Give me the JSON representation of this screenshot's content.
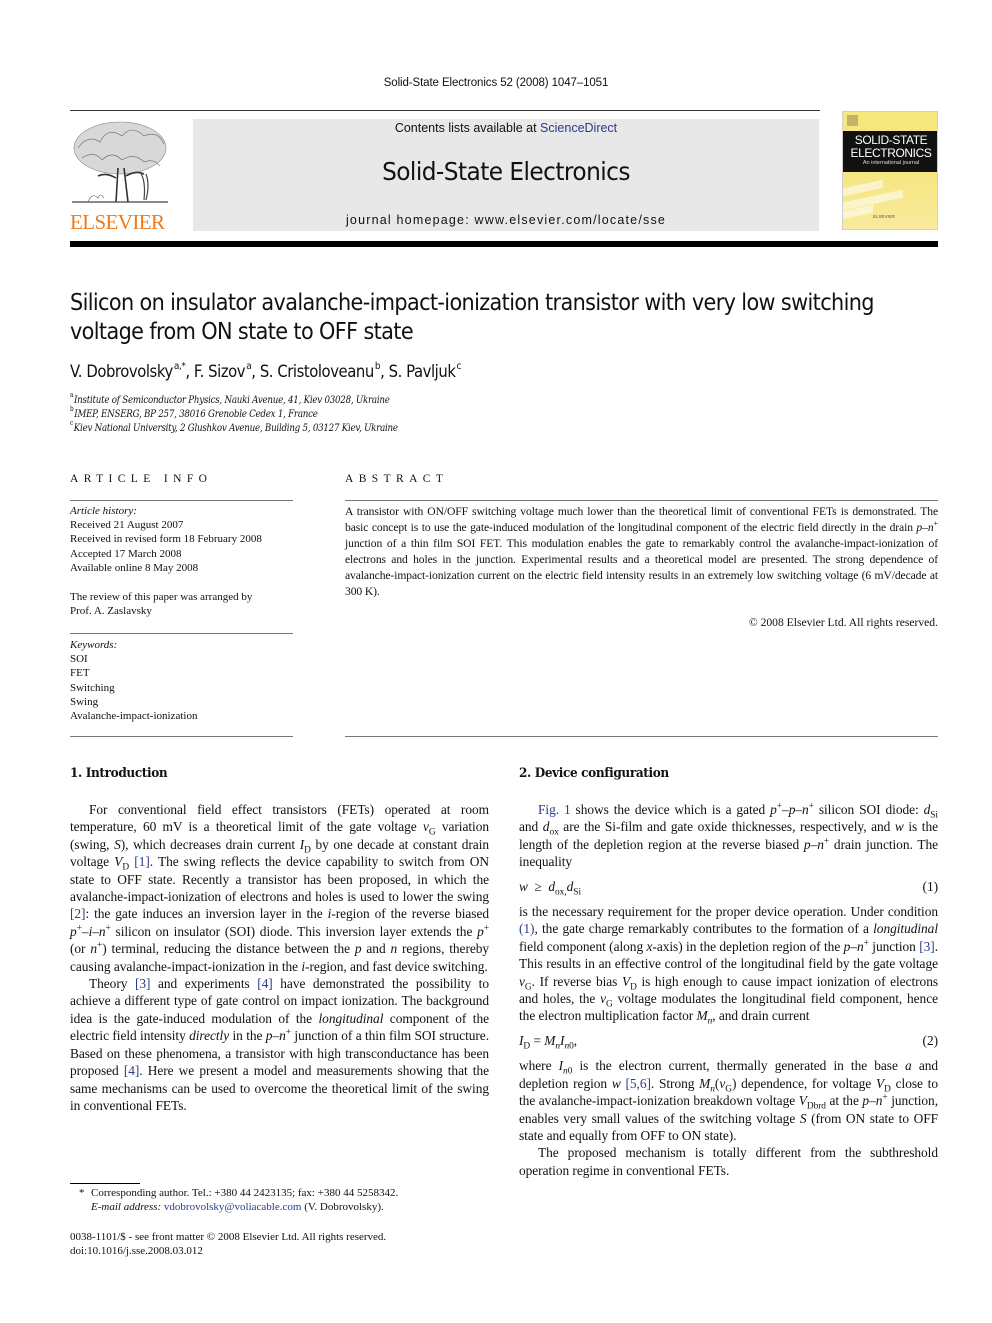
{
  "running_head": "Solid-State Electronics 52 (2008) 1047–1051",
  "header": {
    "publisher_logo_text": "ELSEVIER",
    "contents_prefix": "Contents lists available at ",
    "contents_link": "ScienceDirect",
    "journal_name": "Solid-State Electronics",
    "homepage": "journal homepage: www.elsevier.com/locate/sse",
    "cover": {
      "title_line1": "SOLID-STATE",
      "title_line2": "ELECTRONICS",
      "subtitle": "An international journal",
      "publisher": "ELSEVIER"
    },
    "colors": {
      "elsevier_orange": "#f07a16",
      "link_blue": "#2a3a8c",
      "box_gray": "#e8e8e8",
      "cover_yellow": "#f6e47a"
    }
  },
  "article": {
    "title": "Silicon on insulator avalanche-impact-ionization transistor with very low switching voltage from ON state to OFF state",
    "authors": [
      {
        "name": "V. Dobrovolsky",
        "sup": "a,*"
      },
      {
        "name": "F. Sizov",
        "sup": "a"
      },
      {
        "name": "S. Cristoloveanu",
        "sup": "b"
      },
      {
        "name": "S. Pavljuk",
        "sup": "c"
      }
    ],
    "affiliations": [
      {
        "mark": "a",
        "text": "Institute of Semiconductor Physics, Nauki Avenue, 41, Kiev 03028, Ukraine"
      },
      {
        "mark": "b",
        "text": "IMEP, ENSERG, BP 257, 38016 Grenoble Cedex 1, France"
      },
      {
        "mark": "c",
        "text": "Kiev National University, 2 Glushkov Avenue, Building 5, 03127 Kiev, Ukraine"
      }
    ]
  },
  "article_info": {
    "heading": "ARTICLE INFO",
    "history_label": "Article history:",
    "history": [
      "Received 21 August 2007",
      "Received in revised form 18 February 2008",
      "Accepted 17 March 2008",
      "Available online 8 May 2008"
    ],
    "review_note": [
      "The review of this paper was arranged by",
      "Prof. A. Zaslavsky"
    ],
    "keywords_label": "Keywords:",
    "keywords": [
      "SOI",
      "FET",
      "Switching",
      "Swing",
      "Avalanche-impact-ionization"
    ]
  },
  "abstract": {
    "heading": "ABSTRACT",
    "text_html": "A transistor with ON/OFF switching voltage much lower than the theoretical limit of conventional FETs is demonstrated. The basic concept is to use the gate-induced modulation of the longitudinal component of the electric field directly in the drain <i>p</i>–<i>n</i><sup>+</sup> junction of a thin film SOI FET. This modulation enables the gate to remarkably control the avalanche-impact-ionization of electrons and holes in the junction. Experimental results and a theoretical model are presented. The strong dependence of avalanche-impact-ionization current on the electric field intensity results in an extremely low switching voltage (6 mV/decade at 300 K).",
    "copyright": "© 2008 Elsevier Ltd. All rights reserved."
  },
  "sections": {
    "intro": {
      "heading": "1. Introduction",
      "paragraphs_html": [
        "For conventional field effect transistors (FETs) operated at room temperature, 60 mV is a theoretical limit of the gate voltage <i>v</i><sub>G</sub> variation (swing, <i>S</i>), which decreases drain current <i>I</i><sub>D</sub> by one decade at constant drain voltage <i>V</i><sub>D</sub> <span class=\"link\">[1]</span>. The swing reflects the device capability to switch from ON state to OFF state. Recently a transistor has been proposed, in which the avalanche-impact-ionization of electrons and holes is used to lower the swing <span class=\"link\">[2]</span>: the gate induces an inversion layer in the <i>i</i>-region of the reverse biased <i>p</i><sup>+</sup>–<i>i</i>–<i>n</i><sup>+</sup> silicon on insulator (SOI) diode. This inversion layer extends the <i>p</i><sup>+</sup> (or <i>n</i><sup>+</sup>) terminal, reducing the distance between the <i>p</i> and <i>n</i> regions, thereby causing avalanche-impact-ionization in the <i>i</i>-region, and fast device switching.",
        "Theory <span class=\"link\">[3]</span> and experiments <span class=\"link\">[4]</span> have demonstrated the possibility to achieve a different type of gate control on impact ionization. The background idea is the gate-induced modulation of the <i>longitudinal</i> component of the electric field intensity <i>directly</i> in the <i>p</i>–<i>n</i><sup>+</sup> junction of a thin film SOI structure. Based on these phenomena, a transistor with high transconductance has been proposed <span class=\"link\">[4]</span>. Here we present a model and measurements showing that the same mechanisms can be used to overcome the theoretical limit of the swing in conventional FETs."
      ]
    },
    "device": {
      "heading": "2. Device configuration",
      "para1_html": "<span class=\"link\">Fig. 1</span> shows the device which is a gated <i>p</i><sup>+</sup>–<i>p</i>–<i>n</i><sup>+</sup> silicon SOI diode: <i>d</i><sub>Si</sub> and <i>d</i><sub>ox</sub> are the Si-film and gate oxide thicknesses, respectively, and <i>w</i> is the length of the depletion region at the reverse biased <i>p</i>–<i>n</i><sup>+</sup> drain junction. The inequality",
      "eq1_html": "<i>w</i>&nbsp;&nbsp;≥&nbsp;&nbsp;<i>d</i><sub>ox,</sub><i>d</i><sub>Si</sub>",
      "eq1_num": "(1)",
      "para2_html": "is the necessary requirement for the proper device operation. Under condition <span class=\"link\">(1)</span>, the gate charge remarkably contributes to the formation of a <i>longitudinal</i> field component (along <i>x</i>-axis) in the depletion region of the <i>p</i>–<i>n</i><sup>+</sup> junction <span class=\"link\">[3]</span>. This results in an effective control of the longitudinal field by the gate voltage <i>v</i><sub>G</sub>. If reverse bias <i>V</i><sub>D</sub> is high enough to cause impact ionization of electrons and holes, the <i>v</i><sub>G</sub> voltage modulates the longitudinal field component, hence the electron multiplication factor <i>M</i><sub><i>n</i></sub>, and drain current",
      "eq2_html": "<i>I</i><sub>D</sub> = <i>M</i><sub><i>n</i></sub><i>I</i><sub><i>n</i>0</sub>,",
      "eq2_num": "(2)",
      "para3_html": "where <i>I</i><sub><i>n</i>0</sub> is the electron current, thermally generated in the base <i>a</i> and depletion region <i>w</i> <span class=\"link\">[5,6]</span>. Strong <i>M</i><sub><i>n</i></sub>(<i>v</i><sub>G</sub>) dependence, for voltage <i>V</i><sub>D</sub> close to the avalanche-impact-ionization breakdown voltage <i>V</i><sub>Dbrd</sub> at the <i>p</i>–<i>n</i><sup>+</sup> junction, enables very small values of the switching voltage <i>S</i> (from ON state to OFF state and equally from OFF to ON state).",
      "para4_html": "The proposed mechanism is totally different from the subthreshold operation regime in conventional FETs."
    }
  },
  "footnote": {
    "star": "*",
    "line1": "Corresponding author. Tel.: +380 44 2423135; fax: +380 44 5258342.",
    "email_label": "E-mail address:",
    "email": "vdobrovolsky@voliacable.com",
    "email_suffix": " (V. Dobrovolsky)."
  },
  "issn_line": "0038-1101/$ - see front matter © 2008 Elsevier Ltd. All rights reserved.",
  "doi_line": "doi:10.1016/j.sse.2008.03.012"
}
